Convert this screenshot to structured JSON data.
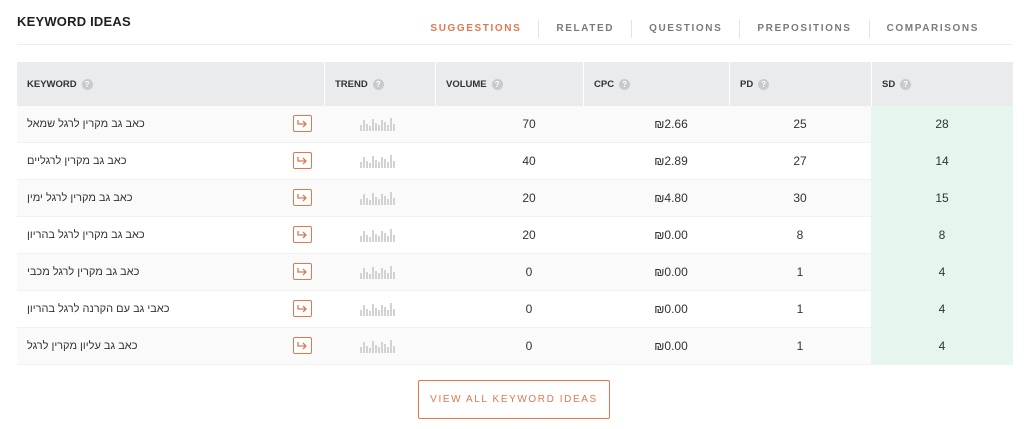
{
  "header": {
    "title": "KEYWORD IDEAS",
    "tabs": [
      {
        "label": "SUGGESTIONS",
        "active": true
      },
      {
        "label": "RELATED",
        "active": false
      },
      {
        "label": "QUESTIONS",
        "active": false
      },
      {
        "label": "PREPOSITIONS",
        "active": false
      },
      {
        "label": "COMPARISONS",
        "active": false
      }
    ]
  },
  "table": {
    "columns": {
      "keyword": "KEYWORD",
      "trend": "TREND",
      "volume": "VOLUME",
      "cpc": "CPC",
      "pd": "PD",
      "sd": "SD"
    },
    "help_glyph": "?",
    "rows": [
      {
        "keyword": "כאב גב מקרין לרגל שמאל",
        "volume": "70",
        "cpc": "₪2.66",
        "pd": "25",
        "sd": "28"
      },
      {
        "keyword": "כאב גב מקרין לרגליים",
        "volume": "40",
        "cpc": "₪2.89",
        "pd": "27",
        "sd": "14"
      },
      {
        "keyword": "כאב גב מקרין לרגל ימין",
        "volume": "20",
        "cpc": "₪4.80",
        "pd": "30",
        "sd": "15"
      },
      {
        "keyword": "כאב גב מקרין לרגל בהריון",
        "volume": "20",
        "cpc": "₪0.00",
        "pd": "8",
        "sd": "8"
      },
      {
        "keyword": "כאב גב מקרין לרגל מכבי",
        "volume": "0",
        "cpc": "₪0.00",
        "pd": "1",
        "sd": "4"
      },
      {
        "keyword": "כאבי גב עם הקרנה לרגל בהריון",
        "volume": "0",
        "cpc": "₪0.00",
        "pd": "1",
        "sd": "4"
      },
      {
        "keyword": "כאב גב עליון מקרין לרגל",
        "volume": "0",
        "cpc": "₪0.00",
        "pd": "1",
        "sd": "4"
      }
    ],
    "trend_icon": "sparkline-icon",
    "row_action_icon": "open-arrow-icon"
  },
  "footer": {
    "view_all_label": "VIEW ALL KEYWORD IDEAS"
  },
  "colors": {
    "accent": "#e2774f",
    "sd_highlight": "#e6f6ee",
    "header_bg": "#e9ebec"
  }
}
